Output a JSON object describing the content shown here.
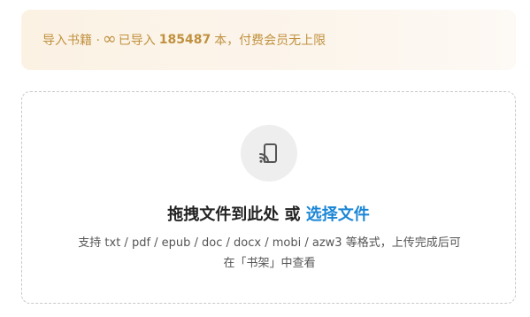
{
  "banner": {
    "prefix": "导入书籍 · ",
    "infinity": "∞",
    "imported_label": " 已导入 ",
    "count": "185487",
    "suffix": " 本，付费会员无上限"
  },
  "dropzone": {
    "icon": "cast-device-icon",
    "title_main": "拖拽文件到此处 或 ",
    "title_link": "选择文件",
    "hint_line1": "支持 txt / pdf / epub / doc / docx / mobi / azw3 等格式，上传完成后可",
    "hint_line2": "在「书架」中查看"
  },
  "colors": {
    "banner_text": "#c0913f",
    "link": "#1a86d6",
    "title": "#222222"
  }
}
